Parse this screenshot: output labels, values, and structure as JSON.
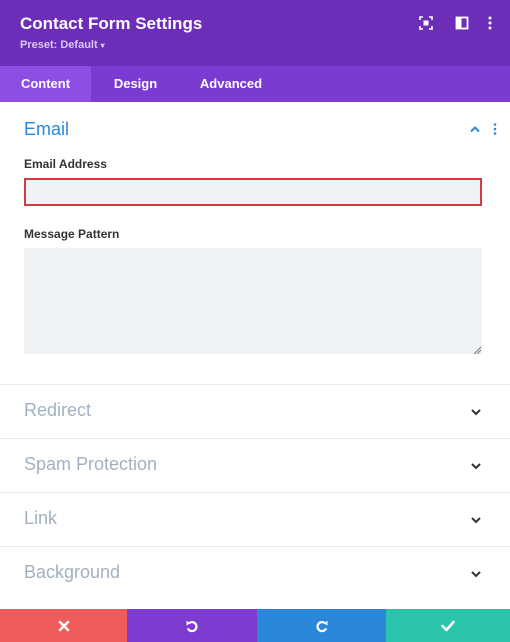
{
  "header": {
    "title": "Contact Form Settings",
    "preset": "Preset: Default",
    "preset_caret": "▾"
  },
  "tabs": [
    {
      "label": "Content",
      "active": true
    },
    {
      "label": "Design",
      "active": false
    },
    {
      "label": "Advanced",
      "active": false
    }
  ],
  "email_section": {
    "title": "Email",
    "email_address_label": "Email Address",
    "email_address_value": "",
    "message_pattern_label": "Message Pattern",
    "message_pattern_value": ""
  },
  "collapsed_sections": [
    "Redirect",
    "Spam Protection",
    "Link",
    "Background"
  ],
  "icons": {
    "header": [
      "focus-icon",
      "split-view-icon",
      "more-vertical-icon"
    ],
    "footer": [
      "close-icon",
      "undo-icon",
      "redo-icon",
      "check-icon"
    ]
  },
  "colors": {
    "header_bg": "#6c2eb9",
    "tabs_bg": "#7b3ad0",
    "active_tab_bg": "#8e4de3",
    "accent_blue": "#2b87da",
    "error_red": "#d33c3c",
    "footer_cancel": "#ef5a5a",
    "footer_undo": "#7d3bcf",
    "footer_redo": "#2b87da",
    "footer_save": "#29c4a9"
  }
}
